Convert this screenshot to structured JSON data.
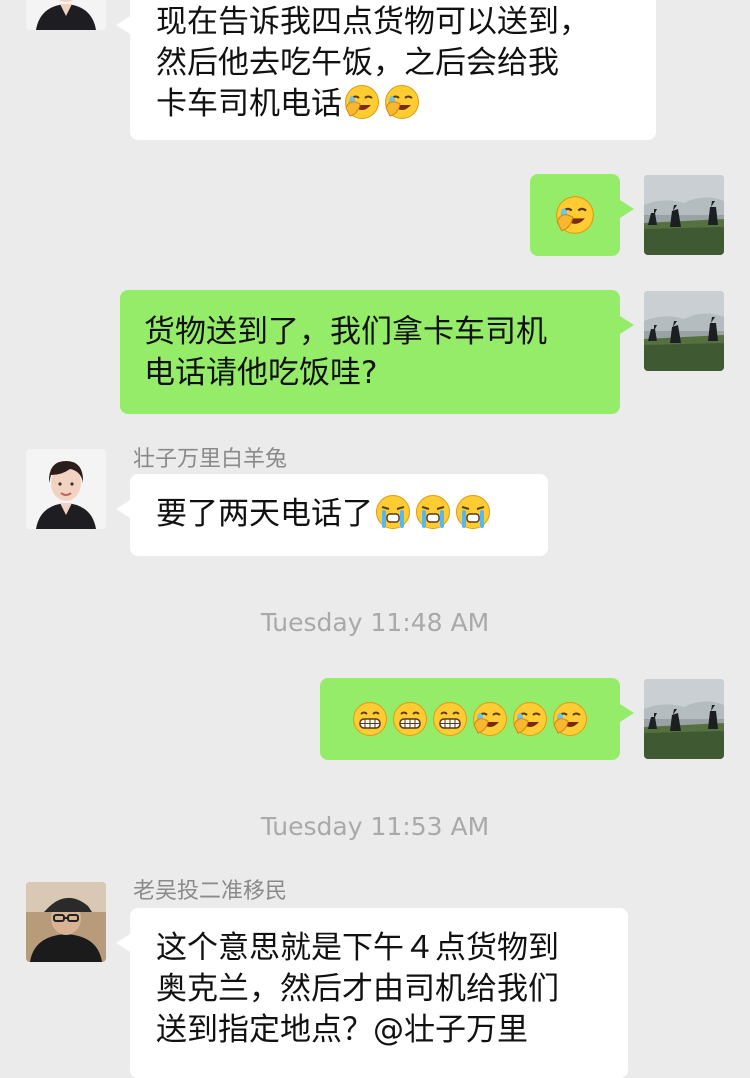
{
  "messages": {
    "m1": {
      "text": "现在告诉我四点货物可以送到，\n然后他去吃午饭，之后会给我\n卡车司机电话",
      "emoji": [
        "facepalm-laugh-icon",
        "facepalm-laugh-icon"
      ]
    },
    "m2": {
      "emoji": [
        "facepalm-laugh-icon"
      ]
    },
    "m3": {
      "text": "货物送到了，我们拿卡车司机\n电话请他吃饭哇?"
    },
    "m4": {
      "sender": "壮子万里白羊兔",
      "text": "要了两天电话了",
      "emoji": [
        "crying-icon",
        "crying-icon",
        "crying-icon"
      ]
    },
    "t1": {
      "text": "Tuesday 11:48 AM"
    },
    "m5": {
      "emoji": [
        "grin-icon",
        "grin-icon",
        "grin-icon",
        "facepalm-laugh-icon",
        "facepalm-laugh-icon",
        "facepalm-laugh-icon"
      ]
    },
    "t2": {
      "text": "Tuesday 11:53 AM"
    },
    "m6": {
      "sender": "老吴投二准移民",
      "text": "这个意思就是下午４点货物到\n奥克兰，然后才由司机给我们\n送到指定地点？@壮子万里"
    }
  },
  "colors": {
    "background": "#ebebeb",
    "incoming_bubble": "#ffffff",
    "outgoing_bubble": "#95ec69",
    "meta_text": "#a9a9a9"
  }
}
